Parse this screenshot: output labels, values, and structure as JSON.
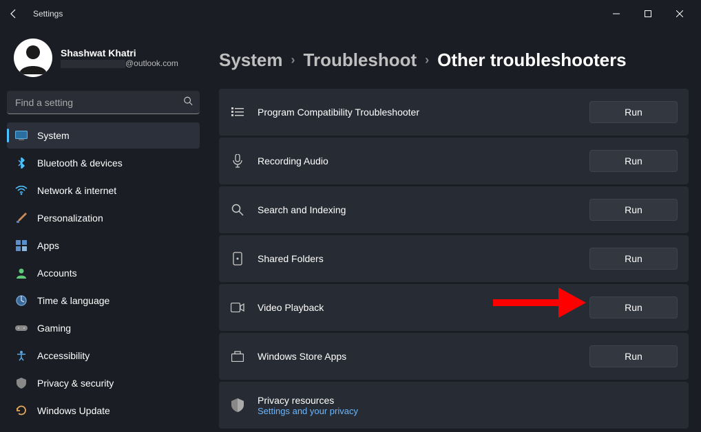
{
  "window": {
    "title": "Settings"
  },
  "profile": {
    "name": "Shashwat Khatri",
    "emailSuffix": "@outlook.com"
  },
  "search": {
    "placeholder": "Find a setting"
  },
  "nav": {
    "items": [
      {
        "label": "System"
      },
      {
        "label": "Bluetooth & devices"
      },
      {
        "label": "Network & internet"
      },
      {
        "label": "Personalization"
      },
      {
        "label": "Apps"
      },
      {
        "label": "Accounts"
      },
      {
        "label": "Time & language"
      },
      {
        "label": "Gaming"
      },
      {
        "label": "Accessibility"
      },
      {
        "label": "Privacy & security"
      },
      {
        "label": "Windows Update"
      }
    ]
  },
  "breadcrumb": {
    "a": "System",
    "b": "Troubleshoot",
    "c": "Other troubleshooters"
  },
  "troubleshooters": {
    "runLabel": "Run",
    "items": [
      {
        "label": "Program Compatibility Troubleshooter"
      },
      {
        "label": "Recording Audio"
      },
      {
        "label": "Search and Indexing"
      },
      {
        "label": "Shared Folders"
      },
      {
        "label": "Video Playback"
      },
      {
        "label": "Windows Store Apps"
      }
    ],
    "privacy": {
      "title": "Privacy resources",
      "link": "Settings and your privacy"
    }
  }
}
